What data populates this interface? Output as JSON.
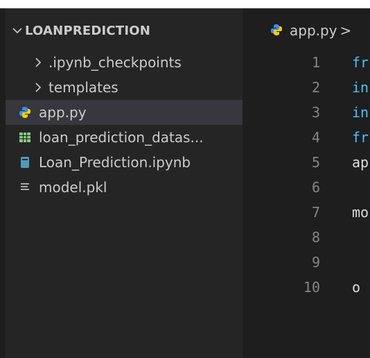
{
  "explorer": {
    "folder_name": "LOANPREDICTION",
    "items": [
      {
        "label": ".ipynb_checkpoints",
        "kind": "folder"
      },
      {
        "label": "templates",
        "kind": "folder"
      },
      {
        "label": "app.py",
        "kind": "python",
        "selected": true
      },
      {
        "label": "loan_prediction_datas...",
        "kind": "csv"
      },
      {
        "label": "Loan_Prediction.ipynb",
        "kind": "notebook"
      },
      {
        "label": "model.pkl",
        "kind": "text"
      }
    ]
  },
  "editor": {
    "breadcrumb_file": "app.py",
    "breadcrumb_sep": ">",
    "line_numbers": [
      "1",
      "2",
      "3",
      "4",
      "5",
      "6",
      "7",
      "8",
      "9",
      "10"
    ],
    "lines": [
      "fr",
      "in",
      "in",
      "fr",
      "ap",
      "",
      "mo",
      "",
      "",
      "o"
    ]
  },
  "colors": {
    "python_icon": "#3b8eea",
    "python_icon_accent": "#f5d000",
    "csv_icon": "#89d185",
    "notebook_icon": "#519aba",
    "keyword": "#4fc1ff"
  }
}
